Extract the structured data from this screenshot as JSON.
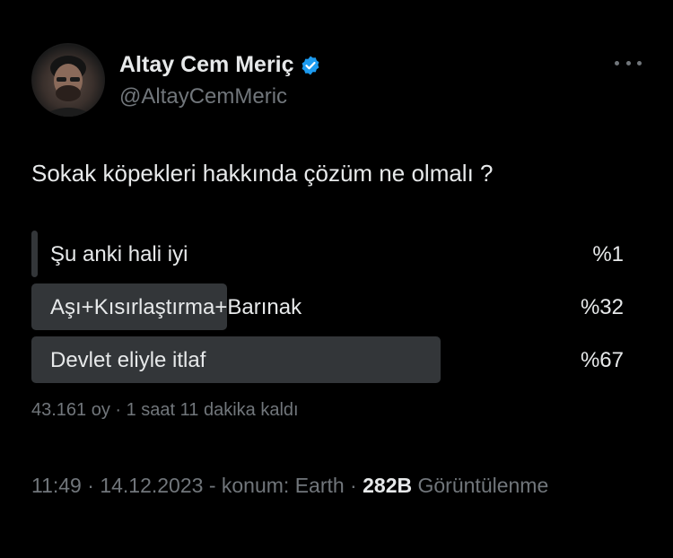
{
  "author": {
    "name": "Altay Cem Meriç",
    "handle": "@AltayCemMeric",
    "verified_icon": "verified-badge-icon",
    "verified_color": "#1d9bf0"
  },
  "tweet": {
    "text": "Sokak köpekleri hakkında çözüm ne olmalı ?"
  },
  "poll": {
    "options": [
      {
        "label": "Şu anki hali iyi",
        "percent_text": "%1",
        "percent": 1
      },
      {
        "label": "Aşı+Kısırlaştırma+Barınak",
        "percent_text": "%32",
        "percent": 32
      },
      {
        "label": "Devlet eliyle itlaf",
        "percent_text": "%67",
        "percent": 67
      }
    ],
    "meta": "43.161 oy · 1 saat 11 dakika kaldı",
    "bar_color": "#333639"
  },
  "footer": {
    "time": "11:49",
    "sep1": " · ",
    "date": "14.12.2023",
    "location": " - konum: Earth",
    "sep2": " · ",
    "views_count": "282B",
    "views_label": " Görüntülenme"
  },
  "colors": {
    "background": "#000000",
    "primary_text": "#e7e9ea",
    "secondary_text": "#71767b"
  }
}
